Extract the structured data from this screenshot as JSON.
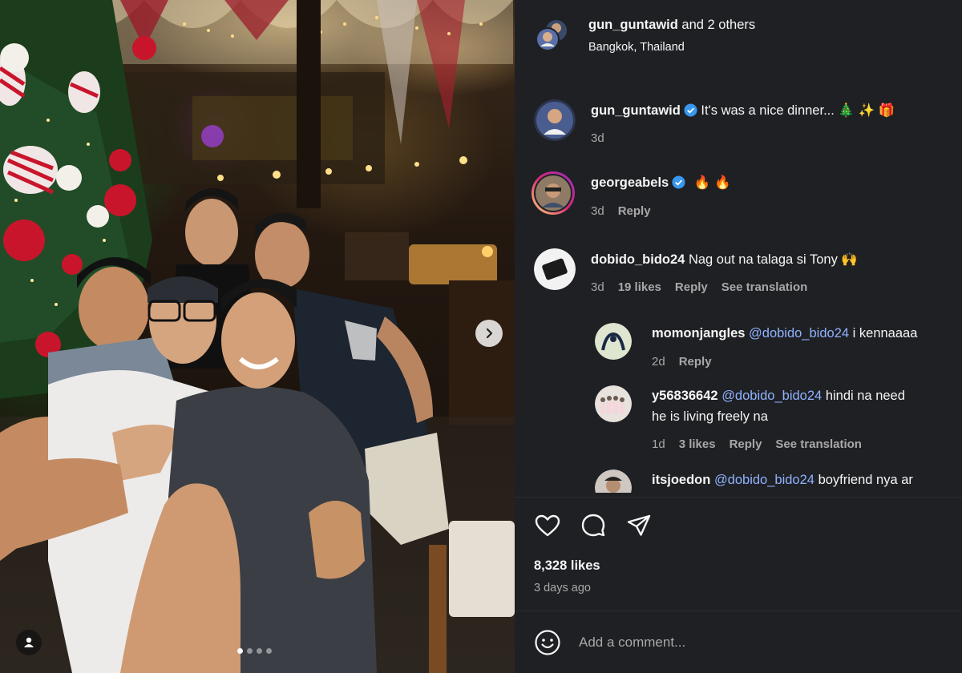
{
  "post": {
    "header": {
      "author": "gun_guntawid",
      "coauthors_text": "and 2 others",
      "location": "Bangkok, Thailand"
    },
    "carousel": {
      "total_slides": 4,
      "active_slide": 1
    },
    "likes": "8,328 likes",
    "posted_ago": "3 days ago",
    "add_comment_placeholder": "Add a comment..."
  },
  "caption": {
    "username": "gun_guntawid",
    "verified": true,
    "text": "It's was a nice dinner... 🎄 ✨ 🎁",
    "time": "3d"
  },
  "comments": [
    {
      "username": "georgeabels",
      "verified": true,
      "text": "🔥 🔥",
      "time": "3d",
      "reply_label": "Reply"
    },
    {
      "username": "dobido_bido24",
      "verified": false,
      "text": "Nag out na talaga si Tony 🙌",
      "time": "3d",
      "likes": "19 likes",
      "reply_label": "Reply",
      "translate_label": "See translation"
    }
  ],
  "replies": [
    {
      "username": "momonjangles",
      "mention": "@dobido_bido24",
      "text": "i kennaaaa",
      "time": "2d",
      "reply_label": "Reply"
    },
    {
      "username": "y56836642",
      "mention": "@dobido_bido24",
      "text": "hindi na need",
      "text_line2": "he is living freely na",
      "time": "1d",
      "likes": "3 likes",
      "reply_label": "Reply",
      "translate_label": "See translation"
    },
    {
      "username": "itsjoedon",
      "mention": "@dobido_bido24",
      "text": "boyfriend nya ar"
    }
  ],
  "icons": {
    "like": "heart-icon",
    "comment": "comment-icon",
    "share": "send-icon",
    "emoji": "smiley-icon",
    "next": "chevron-right-icon",
    "tags": "user-tag-icon",
    "verified": "verified-badge-icon"
  },
  "colors": {
    "panel_bg": "#1f2024",
    "mention": "#8fb3ff",
    "verified": "#3897f0",
    "muted": "#a8a8a8"
  }
}
